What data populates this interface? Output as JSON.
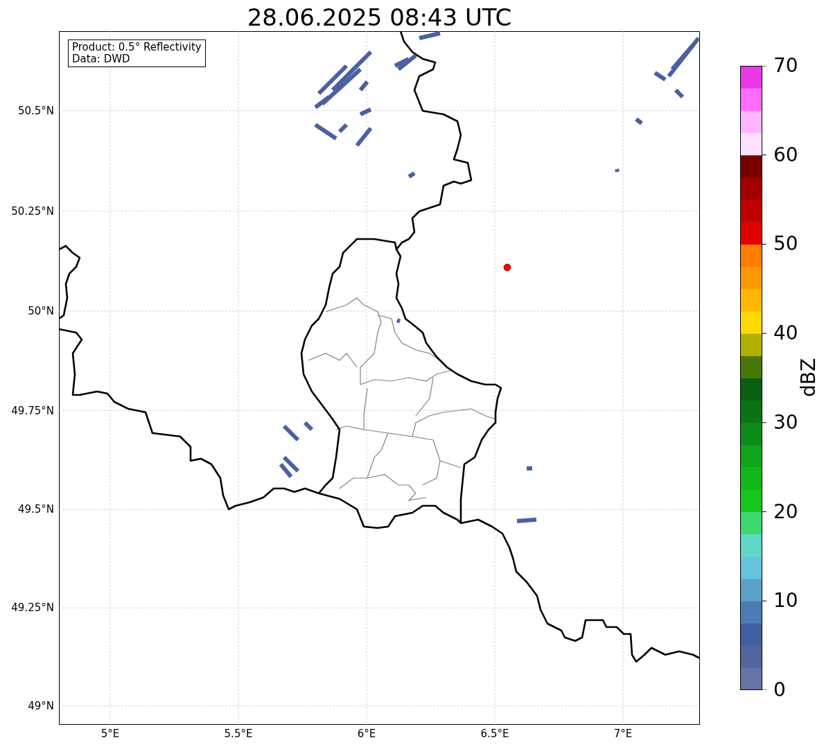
{
  "title": "28.06.2025 08:43 UTC",
  "map": {
    "info_box": [
      "Product: 0.5° Reflectivity",
      "Data: DWD"
    ],
    "yticks": [
      "50.5°N",
      "50.25°N",
      "50°N",
      "49.75°N",
      "49.5°N",
      "49.25°N",
      "49°N"
    ],
    "xticks": [
      "5°E",
      "5.5°E",
      "6°E",
      "6.5°E",
      "7°E"
    ]
  },
  "colorbar": {
    "ticks": [
      "70",
      "60",
      "50",
      "40",
      "30",
      "20",
      "10",
      "0"
    ],
    "label": "dBZ",
    "bands": [
      {
        "color": "#6674a6"
      },
      {
        "color": "#5366a0"
      },
      {
        "color": "#435fa3"
      },
      {
        "color": "#4b7cb5"
      },
      {
        "color": "#5aa0c8"
      },
      {
        "color": "#65c3dc"
      },
      {
        "color": "#60d8c8"
      },
      {
        "color": "#3dd870"
      },
      {
        "color": "#13c81a"
      },
      {
        "color": "#10b81a"
      },
      {
        "color": "#0ea518"
      },
      {
        "color": "#0c8c18"
      },
      {
        "color": "#0a7414"
      },
      {
        "color": "#095e10"
      },
      {
        "color": "#487808"
      },
      {
        "color": "#b0b000"
      },
      {
        "color": "#ffd800"
      },
      {
        "color": "#ffb800"
      },
      {
        "color": "#ff9800"
      },
      {
        "color": "#ff7c00"
      },
      {
        "color": "#e00000"
      },
      {
        "color": "#c00000"
      },
      {
        "color": "#a00000"
      },
      {
        "color": "#780000"
      },
      {
        "color": "#ffe0ff"
      },
      {
        "color": "#ffb4ff"
      },
      {
        "color": "#ff6cff"
      },
      {
        "color": "#e838e8"
      }
    ]
  }
}
